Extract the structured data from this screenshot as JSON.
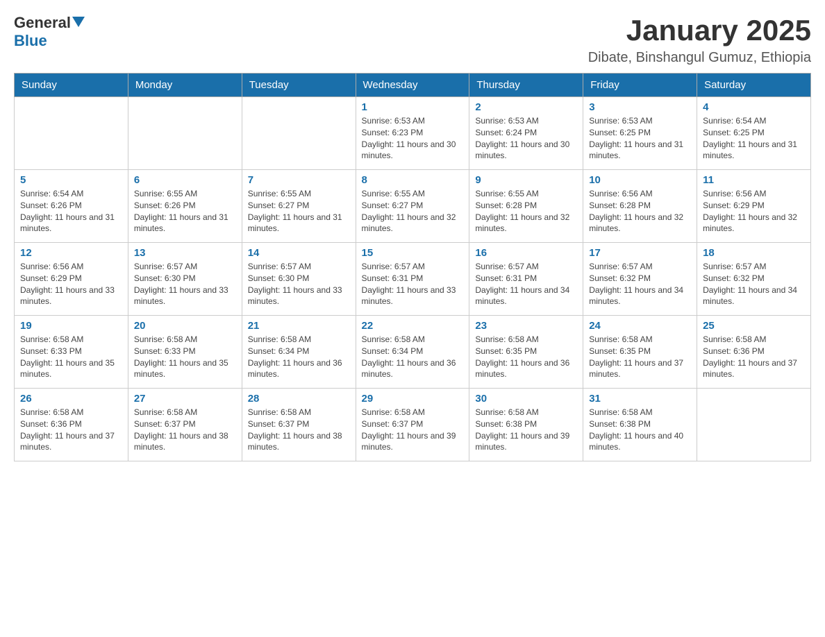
{
  "header": {
    "logo_general": "General",
    "logo_blue": "Blue",
    "month_title": "January 2025",
    "location": "Dibate, Binshangul Gumuz, Ethiopia"
  },
  "weekdays": [
    "Sunday",
    "Monday",
    "Tuesday",
    "Wednesday",
    "Thursday",
    "Friday",
    "Saturday"
  ],
  "weeks": [
    [
      {
        "day": "",
        "info": ""
      },
      {
        "day": "",
        "info": ""
      },
      {
        "day": "",
        "info": ""
      },
      {
        "day": "1",
        "info": "Sunrise: 6:53 AM\nSunset: 6:23 PM\nDaylight: 11 hours and 30 minutes."
      },
      {
        "day": "2",
        "info": "Sunrise: 6:53 AM\nSunset: 6:24 PM\nDaylight: 11 hours and 30 minutes."
      },
      {
        "day": "3",
        "info": "Sunrise: 6:53 AM\nSunset: 6:25 PM\nDaylight: 11 hours and 31 minutes."
      },
      {
        "day": "4",
        "info": "Sunrise: 6:54 AM\nSunset: 6:25 PM\nDaylight: 11 hours and 31 minutes."
      }
    ],
    [
      {
        "day": "5",
        "info": "Sunrise: 6:54 AM\nSunset: 6:26 PM\nDaylight: 11 hours and 31 minutes."
      },
      {
        "day": "6",
        "info": "Sunrise: 6:55 AM\nSunset: 6:26 PM\nDaylight: 11 hours and 31 minutes."
      },
      {
        "day": "7",
        "info": "Sunrise: 6:55 AM\nSunset: 6:27 PM\nDaylight: 11 hours and 31 minutes."
      },
      {
        "day": "8",
        "info": "Sunrise: 6:55 AM\nSunset: 6:27 PM\nDaylight: 11 hours and 32 minutes."
      },
      {
        "day": "9",
        "info": "Sunrise: 6:55 AM\nSunset: 6:28 PM\nDaylight: 11 hours and 32 minutes."
      },
      {
        "day": "10",
        "info": "Sunrise: 6:56 AM\nSunset: 6:28 PM\nDaylight: 11 hours and 32 minutes."
      },
      {
        "day": "11",
        "info": "Sunrise: 6:56 AM\nSunset: 6:29 PM\nDaylight: 11 hours and 32 minutes."
      }
    ],
    [
      {
        "day": "12",
        "info": "Sunrise: 6:56 AM\nSunset: 6:29 PM\nDaylight: 11 hours and 33 minutes."
      },
      {
        "day": "13",
        "info": "Sunrise: 6:57 AM\nSunset: 6:30 PM\nDaylight: 11 hours and 33 minutes."
      },
      {
        "day": "14",
        "info": "Sunrise: 6:57 AM\nSunset: 6:30 PM\nDaylight: 11 hours and 33 minutes."
      },
      {
        "day": "15",
        "info": "Sunrise: 6:57 AM\nSunset: 6:31 PM\nDaylight: 11 hours and 33 minutes."
      },
      {
        "day": "16",
        "info": "Sunrise: 6:57 AM\nSunset: 6:31 PM\nDaylight: 11 hours and 34 minutes."
      },
      {
        "day": "17",
        "info": "Sunrise: 6:57 AM\nSunset: 6:32 PM\nDaylight: 11 hours and 34 minutes."
      },
      {
        "day": "18",
        "info": "Sunrise: 6:57 AM\nSunset: 6:32 PM\nDaylight: 11 hours and 34 minutes."
      }
    ],
    [
      {
        "day": "19",
        "info": "Sunrise: 6:58 AM\nSunset: 6:33 PM\nDaylight: 11 hours and 35 minutes."
      },
      {
        "day": "20",
        "info": "Sunrise: 6:58 AM\nSunset: 6:33 PM\nDaylight: 11 hours and 35 minutes."
      },
      {
        "day": "21",
        "info": "Sunrise: 6:58 AM\nSunset: 6:34 PM\nDaylight: 11 hours and 36 minutes."
      },
      {
        "day": "22",
        "info": "Sunrise: 6:58 AM\nSunset: 6:34 PM\nDaylight: 11 hours and 36 minutes."
      },
      {
        "day": "23",
        "info": "Sunrise: 6:58 AM\nSunset: 6:35 PM\nDaylight: 11 hours and 36 minutes."
      },
      {
        "day": "24",
        "info": "Sunrise: 6:58 AM\nSunset: 6:35 PM\nDaylight: 11 hours and 37 minutes."
      },
      {
        "day": "25",
        "info": "Sunrise: 6:58 AM\nSunset: 6:36 PM\nDaylight: 11 hours and 37 minutes."
      }
    ],
    [
      {
        "day": "26",
        "info": "Sunrise: 6:58 AM\nSunset: 6:36 PM\nDaylight: 11 hours and 37 minutes."
      },
      {
        "day": "27",
        "info": "Sunrise: 6:58 AM\nSunset: 6:37 PM\nDaylight: 11 hours and 38 minutes."
      },
      {
        "day": "28",
        "info": "Sunrise: 6:58 AM\nSunset: 6:37 PM\nDaylight: 11 hours and 38 minutes."
      },
      {
        "day": "29",
        "info": "Sunrise: 6:58 AM\nSunset: 6:37 PM\nDaylight: 11 hours and 39 minutes."
      },
      {
        "day": "30",
        "info": "Sunrise: 6:58 AM\nSunset: 6:38 PM\nDaylight: 11 hours and 39 minutes."
      },
      {
        "day": "31",
        "info": "Sunrise: 6:58 AM\nSunset: 6:38 PM\nDaylight: 11 hours and 40 minutes."
      },
      {
        "day": "",
        "info": ""
      }
    ]
  ]
}
